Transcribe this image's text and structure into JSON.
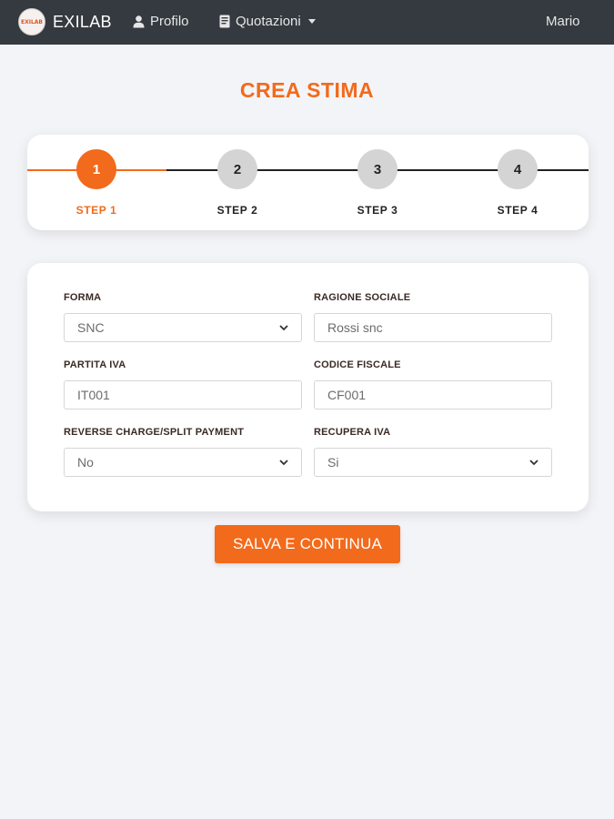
{
  "navbar": {
    "brand_logo_text": "EXILAB",
    "brand": "EXILAB",
    "profile_label": "Profilo",
    "quotations_label": "Quotazioni",
    "user_name": "Mario"
  },
  "page": {
    "title": "CREA STIMA"
  },
  "stepper": {
    "current_step": 1,
    "steps": [
      {
        "number": "1",
        "label": "STEP 1"
      },
      {
        "number": "2",
        "label": "STEP 2"
      },
      {
        "number": "3",
        "label": "STEP 3"
      },
      {
        "number": "4",
        "label": "STEP 4"
      }
    ]
  },
  "form": {
    "forma": {
      "label": "FORMA",
      "value": "SNC"
    },
    "ragione_sociale": {
      "label": "RAGIONE SOCIALE",
      "value": "Rossi snc"
    },
    "partita_iva": {
      "label": "PARTITA IVA",
      "value": "IT001"
    },
    "codice_fiscale": {
      "label": "CODICE FISCALE",
      "value": "CF001"
    },
    "reverse_charge": {
      "label": "REVERSE CHARGE/SPLIT PAYMENT",
      "value": "No"
    },
    "recupera_iva": {
      "label": "RECUPERA IVA",
      "value": "Si"
    }
  },
  "actions": {
    "save_continue_label": "SALVA E CONTINUA"
  },
  "colors": {
    "accent": "#f26a1b",
    "navbar_bg": "#343a40",
    "page_bg": "#f3f4f7",
    "step_inactive": "#d4d4d4"
  },
  "icons": {
    "profile": "user-icon",
    "quotations": "document-icon",
    "select_arrow": "chevron-down-icon"
  }
}
